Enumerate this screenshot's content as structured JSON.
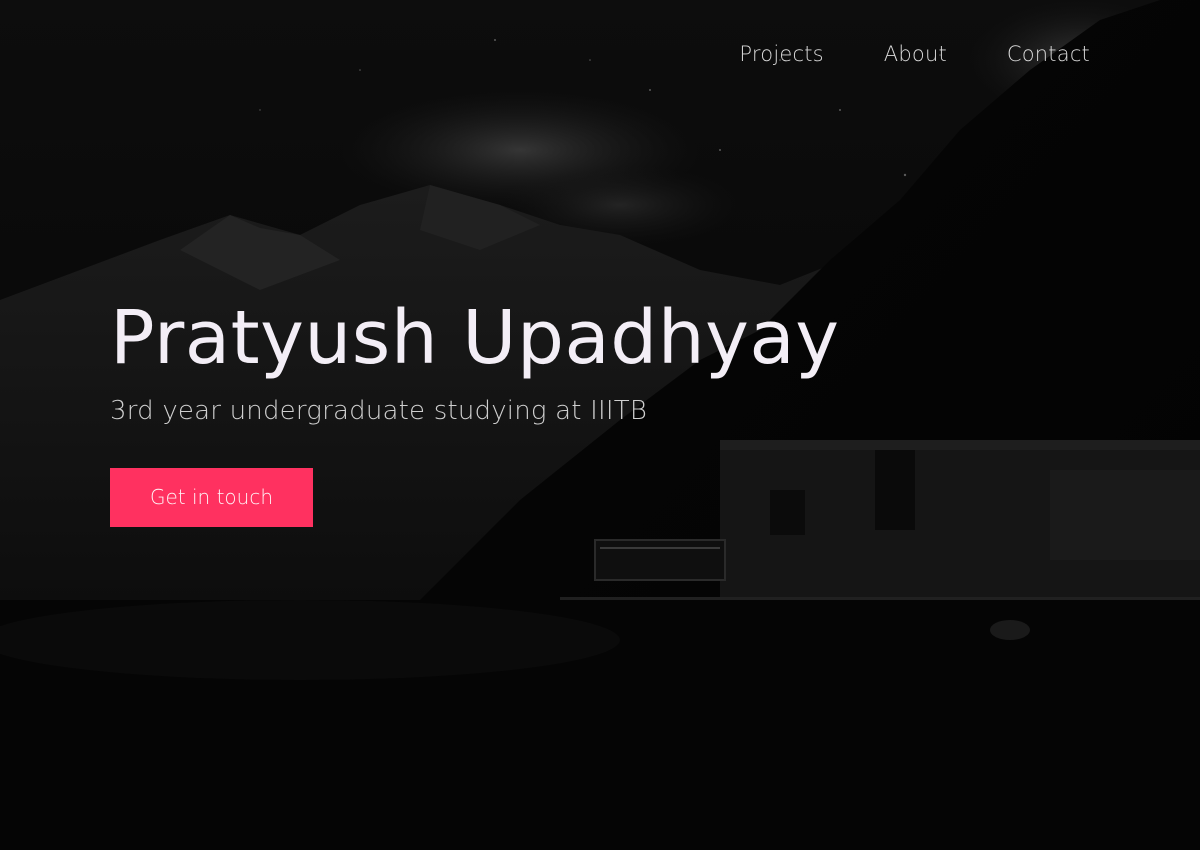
{
  "nav": {
    "items": [
      {
        "label": "Projects"
      },
      {
        "label": "About"
      },
      {
        "label": "Contact"
      }
    ]
  },
  "hero": {
    "name": "Pratyush Upadhyay",
    "subtitle": "3rd year undergraduate studying at IIITB",
    "cta_label": "Get in touch"
  },
  "colors": {
    "background": "#060606",
    "accent": "#ff3160",
    "heading": "#f3eef6",
    "subtext": "#cfcfcf",
    "nav": "#d9d9d9"
  }
}
